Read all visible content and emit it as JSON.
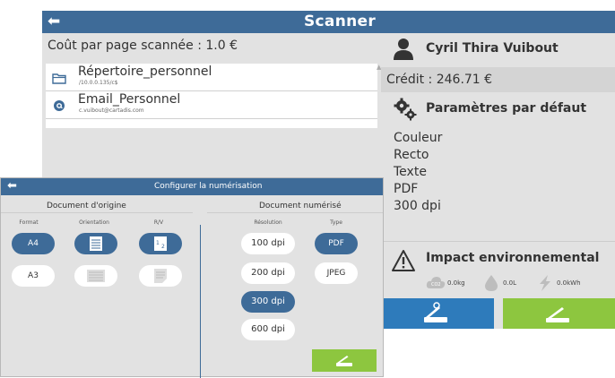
{
  "scanner": {
    "title": "Scanner",
    "back_icon": "back-arrow-icon",
    "cost_label": "Coût par page scannée : 1.0 €",
    "destinations": [
      {
        "name": "Répertoire_personnel",
        "sub": "/10.0.0.135/c$",
        "icon": "folder-icon"
      },
      {
        "name": "Email_Personnel",
        "sub": "c.vuibout@cartadis.com",
        "icon": "at-icon"
      }
    ],
    "user": {
      "name": "Cyril Thira Vuibout",
      "credit": "Crédit : 246.71 €"
    },
    "defaults": {
      "title": "Paramètres par défaut",
      "items": [
        "Couleur",
        "Recto",
        "Texte",
        "PDF",
        "300 dpi"
      ]
    },
    "environment": {
      "title": "Impact environnemental",
      "co2": "0.0kg",
      "water": "0.0L",
      "energy": "0.0kWh"
    }
  },
  "dialog": {
    "title": "Configurer la numérisation",
    "source_label": "Document d'origine",
    "target_label": "Document numérisé",
    "col_format": "Format",
    "col_orientation": "Orientation",
    "col_rv": "R/V",
    "col_resolution": "Résolution",
    "col_type": "Type",
    "formats": [
      {
        "label": "A4",
        "selected": true
      },
      {
        "label": "A3",
        "selected": false
      }
    ],
    "rv_badge": "1 2",
    "resolutions": [
      {
        "label": "100 dpi",
        "selected": false
      },
      {
        "label": "200 dpi",
        "selected": false
      },
      {
        "label": "300 dpi",
        "selected": true
      },
      {
        "label": "600 dpi",
        "selected": false
      }
    ],
    "types": [
      {
        "label": "PDF",
        "selected": true
      },
      {
        "label": "JPEG",
        "selected": false
      }
    ]
  },
  "colors": {
    "accent": "#3e6b98",
    "green": "#8dc63f",
    "blue_button": "#2e7bbb",
    "panel": "#e2e2e2"
  }
}
